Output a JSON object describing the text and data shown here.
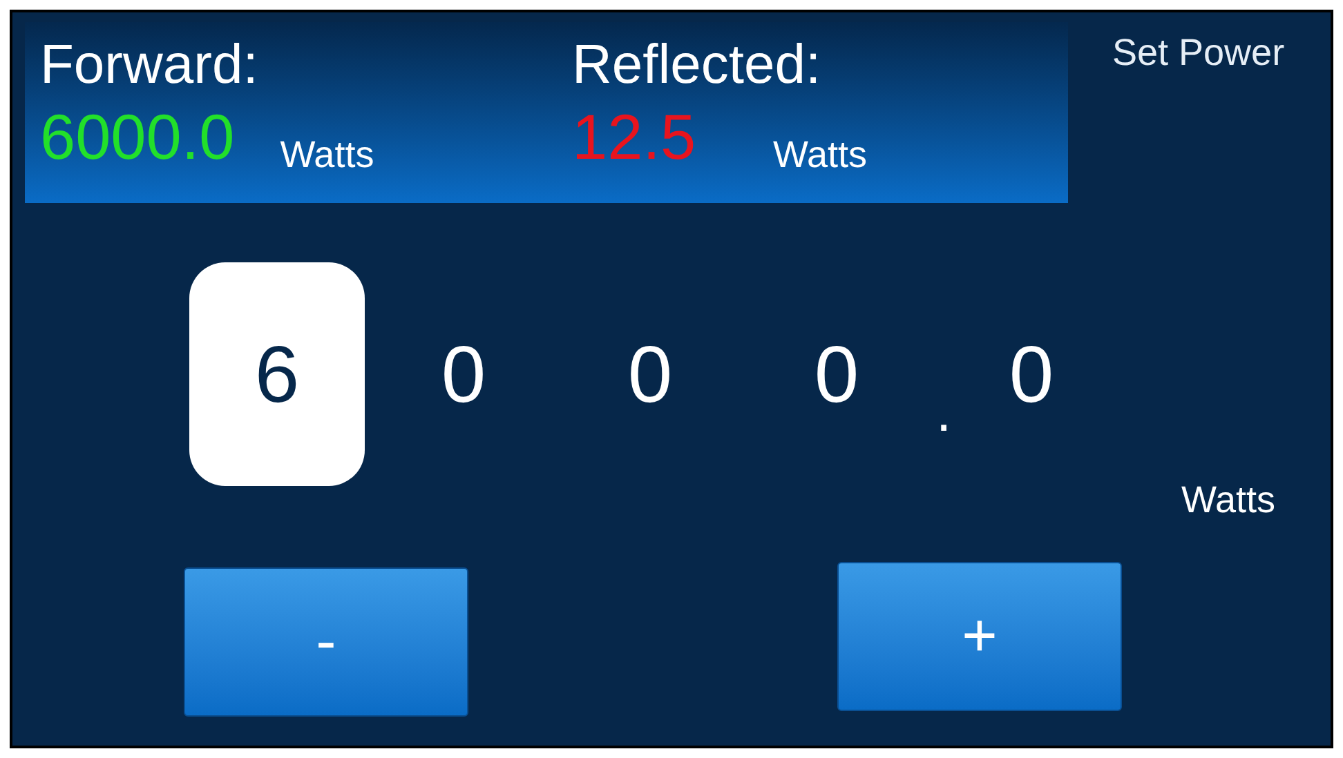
{
  "readings": [
    {
      "label": "Forward:",
      "value": "6000.0",
      "unit": "Watts",
      "color": "#22e02a"
    },
    {
      "label": "Reflected:",
      "value": "12.5",
      "unit": "Watts",
      "color": "#e8141e"
    }
  ],
  "title": "Set Power",
  "digits": [
    {
      "kind": "digit",
      "text": "6",
      "selected": true
    },
    {
      "kind": "digit",
      "text": "0",
      "selected": false
    },
    {
      "kind": "digit",
      "text": "0",
      "selected": false
    },
    {
      "kind": "digit",
      "text": "0",
      "selected": false
    },
    {
      "kind": "point",
      "text": "."
    },
    {
      "kind": "digit",
      "text": "0",
      "selected": false
    }
  ],
  "unit": "Watts",
  "buttons": [
    "-",
    "+"
  ]
}
